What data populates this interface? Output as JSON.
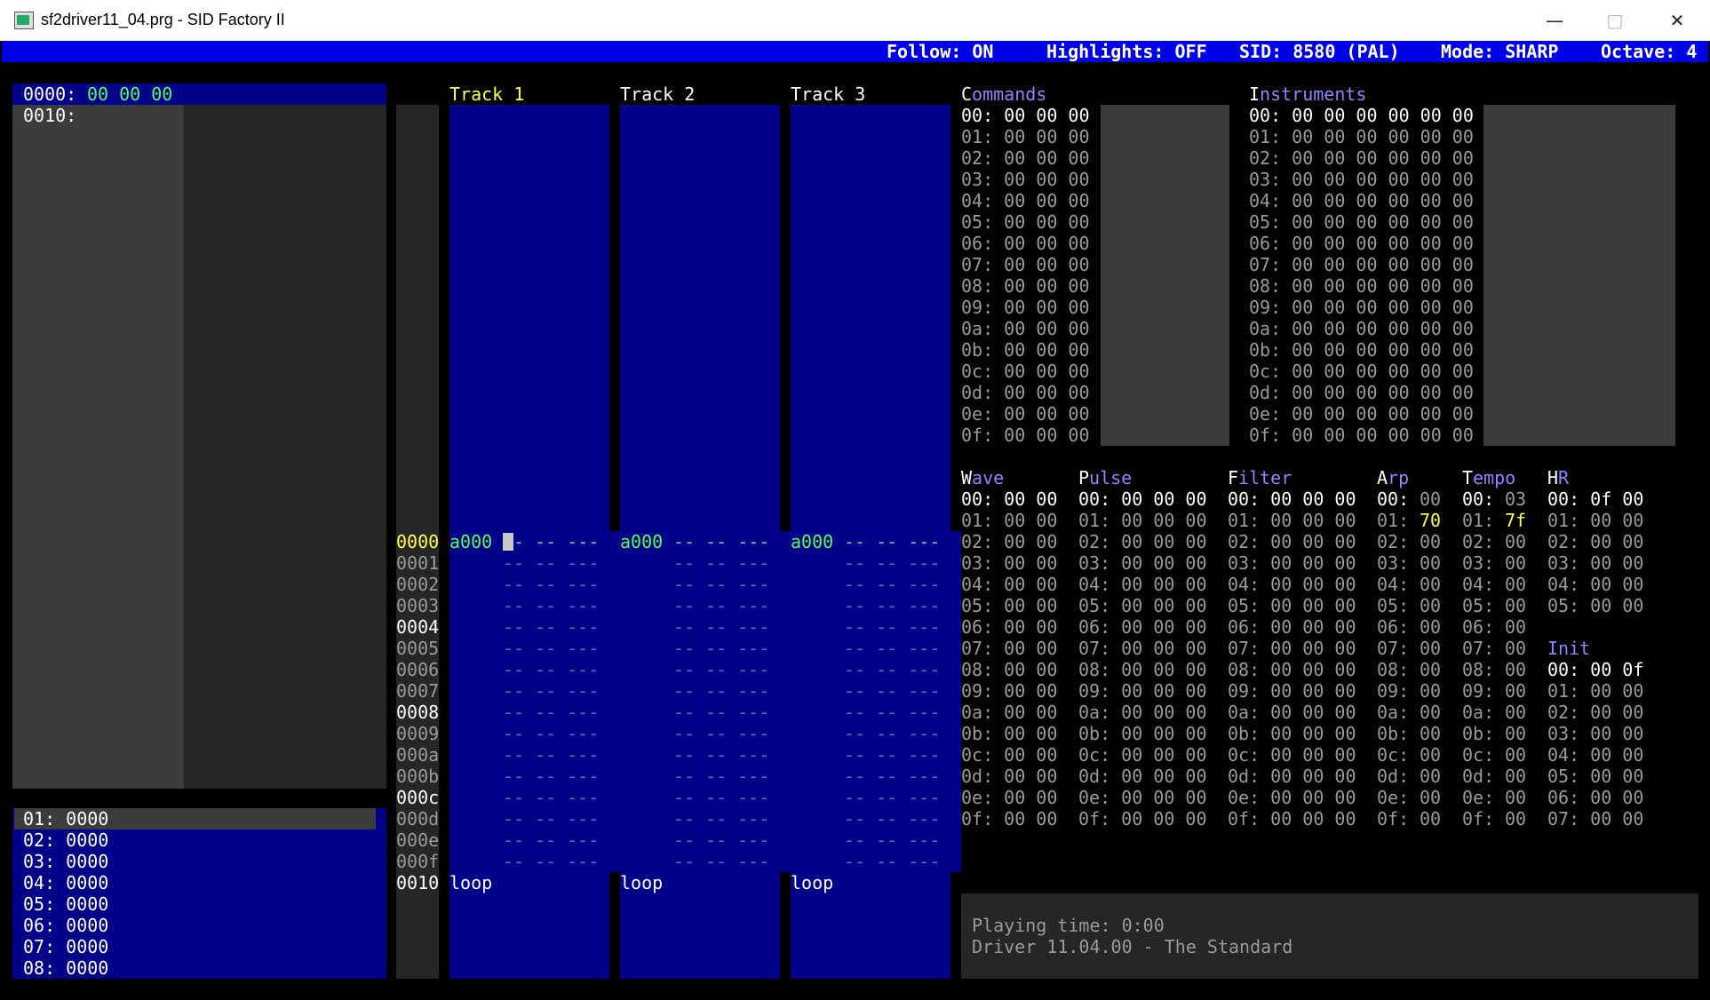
{
  "window": {
    "title": "sf2driver11_04.prg - SID Factory II",
    "minimize_glyph": "—",
    "maximize_glyph": "□",
    "close_glyph": "✕"
  },
  "status": {
    "follow": "Follow: ON",
    "highlights": "Highlights: OFF",
    "sid": "SID: 8580 (PAL)",
    "mode": "Mode: SHARP",
    "octave": "Octave: 4"
  },
  "orderlist": {
    "row0_label": "0000:",
    "row0_values": "00 00 00",
    "row1_label": "0010:"
  },
  "sequences": [
    "01: 0000",
    "02: 0000",
    "03: 0000",
    "04: 0000",
    "05: 0000",
    "06: 0000",
    "07: 0000",
    "08: 0000"
  ],
  "tracks": {
    "headers": [
      "Track 1",
      "Track 2",
      "Track 3"
    ],
    "row_numbers": [
      "0000",
      "0001",
      "0002",
      "0003",
      "0004",
      "0005",
      "0006",
      "0007",
      "0008",
      "0009",
      "000a",
      "000b",
      "000c",
      "000d",
      "000e",
      "000f",
      "0010"
    ],
    "seq_label": "a000",
    "empty_event": "-- -- ---",
    "loop_label": "loop"
  },
  "commands": {
    "title_first": "C",
    "title_rest": "ommands",
    "rows": [
      "00: 00 00 00",
      "01: 00 00 00",
      "02: 00 00 00",
      "03: 00 00 00",
      "04: 00 00 00",
      "05: 00 00 00",
      "06: 00 00 00",
      "07: 00 00 00",
      "08: 00 00 00",
      "09: 00 00 00",
      "0a: 00 00 00",
      "0b: 00 00 00",
      "0c: 00 00 00",
      "0d: 00 00 00",
      "0e: 00 00 00",
      "0f: 00 00 00"
    ]
  },
  "instruments": {
    "title_first": "I",
    "title_rest": "nstruments",
    "rows": [
      "00: 00 00 00 00 00 00",
      "01: 00 00 00 00 00 00",
      "02: 00 00 00 00 00 00",
      "03: 00 00 00 00 00 00",
      "04: 00 00 00 00 00 00",
      "05: 00 00 00 00 00 00",
      "06: 00 00 00 00 00 00",
      "07: 00 00 00 00 00 00",
      "08: 00 00 00 00 00 00",
      "09: 00 00 00 00 00 00",
      "0a: 00 00 00 00 00 00",
      "0b: 00 00 00 00 00 00",
      "0c: 00 00 00 00 00 00",
      "0d: 00 00 00 00 00 00",
      "0e: 00 00 00 00 00 00",
      "0f: 00 00 00 00 00 00"
    ]
  },
  "wave": {
    "title_first": "W",
    "title_rest": "ave",
    "rows": [
      "00: 00 00",
      "01: 00 00",
      "02: 00 00",
      "03: 00 00",
      "04: 00 00",
      "05: 00 00",
      "06: 00 00",
      "07: 00 00",
      "08: 00 00",
      "09: 00 00",
      "0a: 00 00",
      "0b: 00 00",
      "0c: 00 00",
      "0d: 00 00",
      "0e: 00 00",
      "0f: 00 00"
    ]
  },
  "pulse": {
    "title_first": "P",
    "title_rest": "ulse",
    "rows": [
      "00: 00 00 00",
      "01: 00 00 00",
      "02: 00 00 00",
      "03: 00 00 00",
      "04: 00 00 00",
      "05: 00 00 00",
      "06: 00 00 00",
      "07: 00 00 00",
      "08: 00 00 00",
      "09: 00 00 00",
      "0a: 00 00 00",
      "0b: 00 00 00",
      "0c: 00 00 00",
      "0d: 00 00 00",
      "0e: 00 00 00",
      "0f: 00 00 00"
    ]
  },
  "filter": {
    "title_first": "F",
    "title_rest": "ilter",
    "rows": [
      "00: 00 00 00",
      "01: 00 00 00",
      "02: 00 00 00",
      "03: 00 00 00",
      "04: 00 00 00",
      "05: 00 00 00",
      "06: 00 00 00",
      "07: 00 00 00",
      "08: 00 00 00",
      "09: 00 00 00",
      "0a: 00 00 00",
      "0b: 00 00 00",
      "0c: 00 00 00",
      "0d: 00 00 00",
      "0e: 00 00 00",
      "0f: 00 00 00"
    ]
  },
  "arp": {
    "title_first": "A",
    "title_rest": "rp",
    "rows": [
      [
        "00:",
        "00"
      ],
      [
        "01:",
        "70"
      ],
      [
        "02:",
        "00"
      ],
      [
        "03:",
        "00"
      ],
      [
        "04:",
        "00"
      ],
      [
        "05:",
        "00"
      ],
      [
        "06:",
        "00"
      ],
      [
        "07:",
        "00"
      ],
      [
        "08:",
        "00"
      ],
      [
        "09:",
        "00"
      ],
      [
        "0a:",
        "00"
      ],
      [
        "0b:",
        "00"
      ],
      [
        "0c:",
        "00"
      ],
      [
        "0d:",
        "00"
      ],
      [
        "0e:",
        "00"
      ],
      [
        "0f:",
        "00"
      ]
    ]
  },
  "tempo": {
    "title_first": "T",
    "title_rest": "empo",
    "rows": [
      [
        "00:",
        "03"
      ],
      [
        "01:",
        "7f"
      ],
      [
        "02:",
        "00"
      ],
      [
        "03:",
        "00"
      ],
      [
        "04:",
        "00"
      ],
      [
        "05:",
        "00"
      ],
      [
        "06:",
        "00"
      ],
      [
        "07:",
        "00"
      ],
      [
        "08:",
        "00"
      ],
      [
        "09:",
        "00"
      ],
      [
        "0a:",
        "00"
      ],
      [
        "0b:",
        "00"
      ],
      [
        "0c:",
        "00"
      ],
      [
        "0d:",
        "00"
      ],
      [
        "0e:",
        "00"
      ],
      [
        "0f:",
        "00"
      ]
    ]
  },
  "hr": {
    "title_first": "H",
    "title_rest": "R",
    "rows": [
      "00: 0f 00",
      "01: 00 00",
      "02: 00 00",
      "03: 00 00",
      "04: 00 00",
      "05: 00 00"
    ]
  },
  "init": {
    "title": "Init",
    "rows": [
      "00: 00 0f",
      "01: 00 00",
      "02: 00 00",
      "03: 00 00",
      "04: 00 00",
      "05: 00 00",
      "06: 00 00",
      "07: 00 00"
    ]
  },
  "info": {
    "playing_time": "Playing time: 0:00",
    "driver": "Driver 11.04.00 - The Standard"
  },
  "colors": {
    "status_bar": "#0000e6",
    "navy": "#000088",
    "highlight_yellow": "#ffff55",
    "value_green": "#55ff55",
    "title_blue": "#8888ff"
  }
}
